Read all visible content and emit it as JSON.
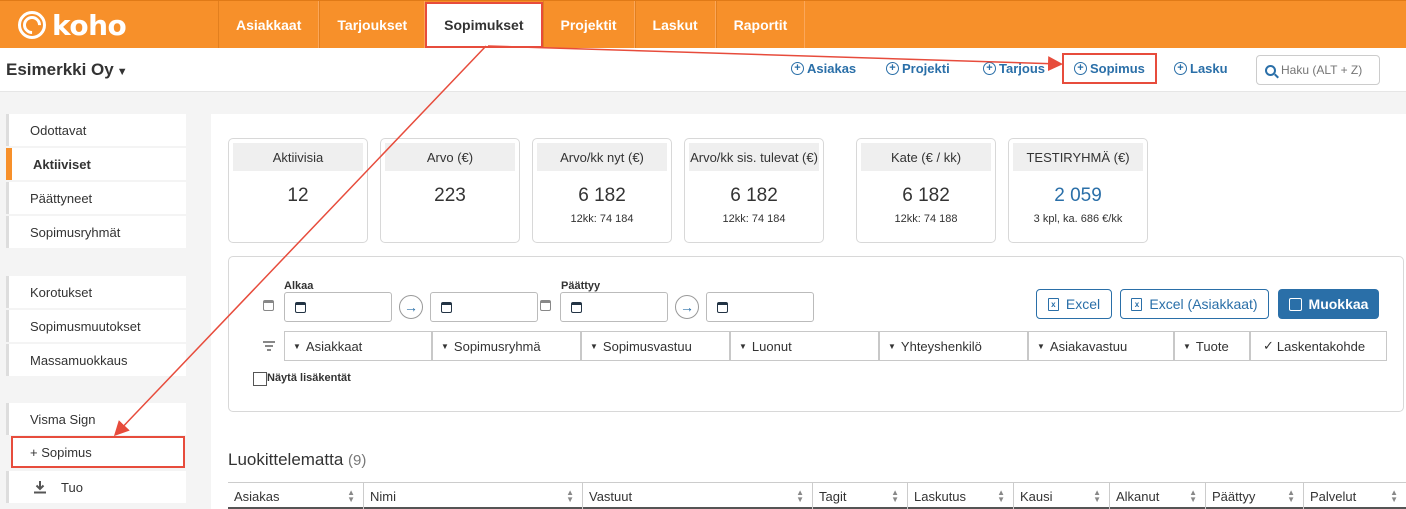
{
  "brand": {
    "logo_text": "koho"
  },
  "nav": {
    "tabs": [
      {
        "label": "Asiakkaat"
      },
      {
        "label": "Tarjoukset"
      },
      {
        "label": "Sopimukset"
      },
      {
        "label": "Projektit"
      },
      {
        "label": "Laskut"
      },
      {
        "label": "Raportit"
      }
    ],
    "active_index": 2
  },
  "header": {
    "company": "Esimerkki Oy",
    "quick_actions": [
      "Asiakas",
      "Projekti",
      "Tarjous",
      "Sopimus",
      "Lasku"
    ],
    "search_placeholder": "Haku (ALT + Z)"
  },
  "sidebar": {
    "group1": [
      "Odottavat",
      "Aktiiviset",
      "Päättyneet",
      "Sopimusryhmät"
    ],
    "group2": [
      "Korotukset",
      "Sopimusmuutokset",
      "Massamuokkaus"
    ],
    "group3": [
      "Visma Sign",
      "+ Sopimus",
      "Tuo"
    ],
    "active": "Aktiiviset"
  },
  "stats": [
    {
      "title": "Aktiivisia",
      "value": "12",
      "sub": ""
    },
    {
      "title": "Arvo (€)",
      "value": "223",
      "sub": ""
    },
    {
      "title": "Arvo/kk nyt (€)",
      "value": "6 182",
      "sub": "12kk: 74 184"
    },
    {
      "title": "Arvo/kk sis. tulevat (€)",
      "value": "6 182",
      "sub": "12kk: 74 184"
    },
    {
      "title": "Kate (€ / kk)",
      "value": "6 182",
      "sub": "12kk: 74 188"
    },
    {
      "title": "TESTIRYHMÄ (€)",
      "value": "2 059",
      "sub": "3 kpl, ka. 686 €/kk"
    }
  ],
  "filters": {
    "start_label": "Alkaa",
    "end_label": "Päättyy",
    "buttons": {
      "excel": "Excel",
      "excel_customers": "Excel (Asiakkaat)",
      "edit": "Muokkaa"
    },
    "dropdowns": [
      "Asiakkaat",
      "Sopimusryhmä",
      "Sopimusvastuu",
      "Luonut",
      "Yhteyshenkilö",
      "Asiakavastuu",
      "Tuote"
    ],
    "check_item": "Laskentakohde",
    "extra_fields_label": "Näytä lisäkentät"
  },
  "table": {
    "section_title": "Luokittelematta",
    "count": "(9)",
    "columns": [
      "Asiakas",
      "Nimi",
      "Vastuut",
      "Tagit",
      "Laskutus",
      "Kausi",
      "Alkanut",
      "Päättyy",
      "Palvelut"
    ]
  },
  "colors": {
    "brand_orange": "#f7902a",
    "link_blue": "#2a6fa8",
    "highlight_red": "#e74c3c"
  }
}
